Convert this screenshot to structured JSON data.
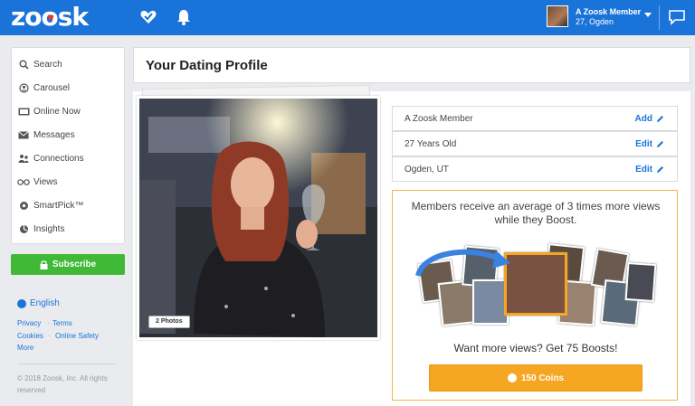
{
  "brand": {
    "logo_text": "zoosk"
  },
  "nav": {
    "icons": [
      "heart-check-icon",
      "bell-icon",
      "chat-icon"
    ]
  },
  "user": {
    "name": "A Zoosk Member",
    "sub": "27, Ogden"
  },
  "sidebar": {
    "items": [
      {
        "label": "Search",
        "icon": "search-icon"
      },
      {
        "label": "Carousel",
        "icon": "carousel-icon"
      },
      {
        "label": "Online Now",
        "icon": "online-icon"
      },
      {
        "label": "Messages",
        "icon": "envelope-icon"
      },
      {
        "label": "Connections",
        "icon": "connections-icon"
      },
      {
        "label": "Views",
        "icon": "glasses-icon"
      },
      {
        "label": "SmartPick™",
        "icon": "smartpick-icon"
      },
      {
        "label": "Insights",
        "icon": "insights-icon"
      }
    ],
    "subscribe_label": "Subscribe",
    "language": "English",
    "links": [
      "Privacy",
      "Terms",
      "Cookies",
      "Online Safety",
      "More"
    ],
    "copyright": "© 2018 Zoosk, Inc. All rights reserved"
  },
  "main": {
    "title": "Your Dating Profile",
    "photo_badge": "2 Photos",
    "info_rows": [
      {
        "label": "A Zoosk Member",
        "action": "Add"
      },
      {
        "label": "27 Years Old",
        "action": "Edit"
      },
      {
        "label": "Ogden, UT",
        "action": "Edit"
      }
    ],
    "boost": {
      "text": "Members receive an average of 3 times more views while they Boost.",
      "cta": "Want more views? Get 75 Boosts!",
      "button_label": "150 Coins"
    }
  },
  "colors": {
    "brand_blue": "#1a73d9",
    "subscribe_green": "#3fb936",
    "boost_orange": "#f5a623"
  }
}
